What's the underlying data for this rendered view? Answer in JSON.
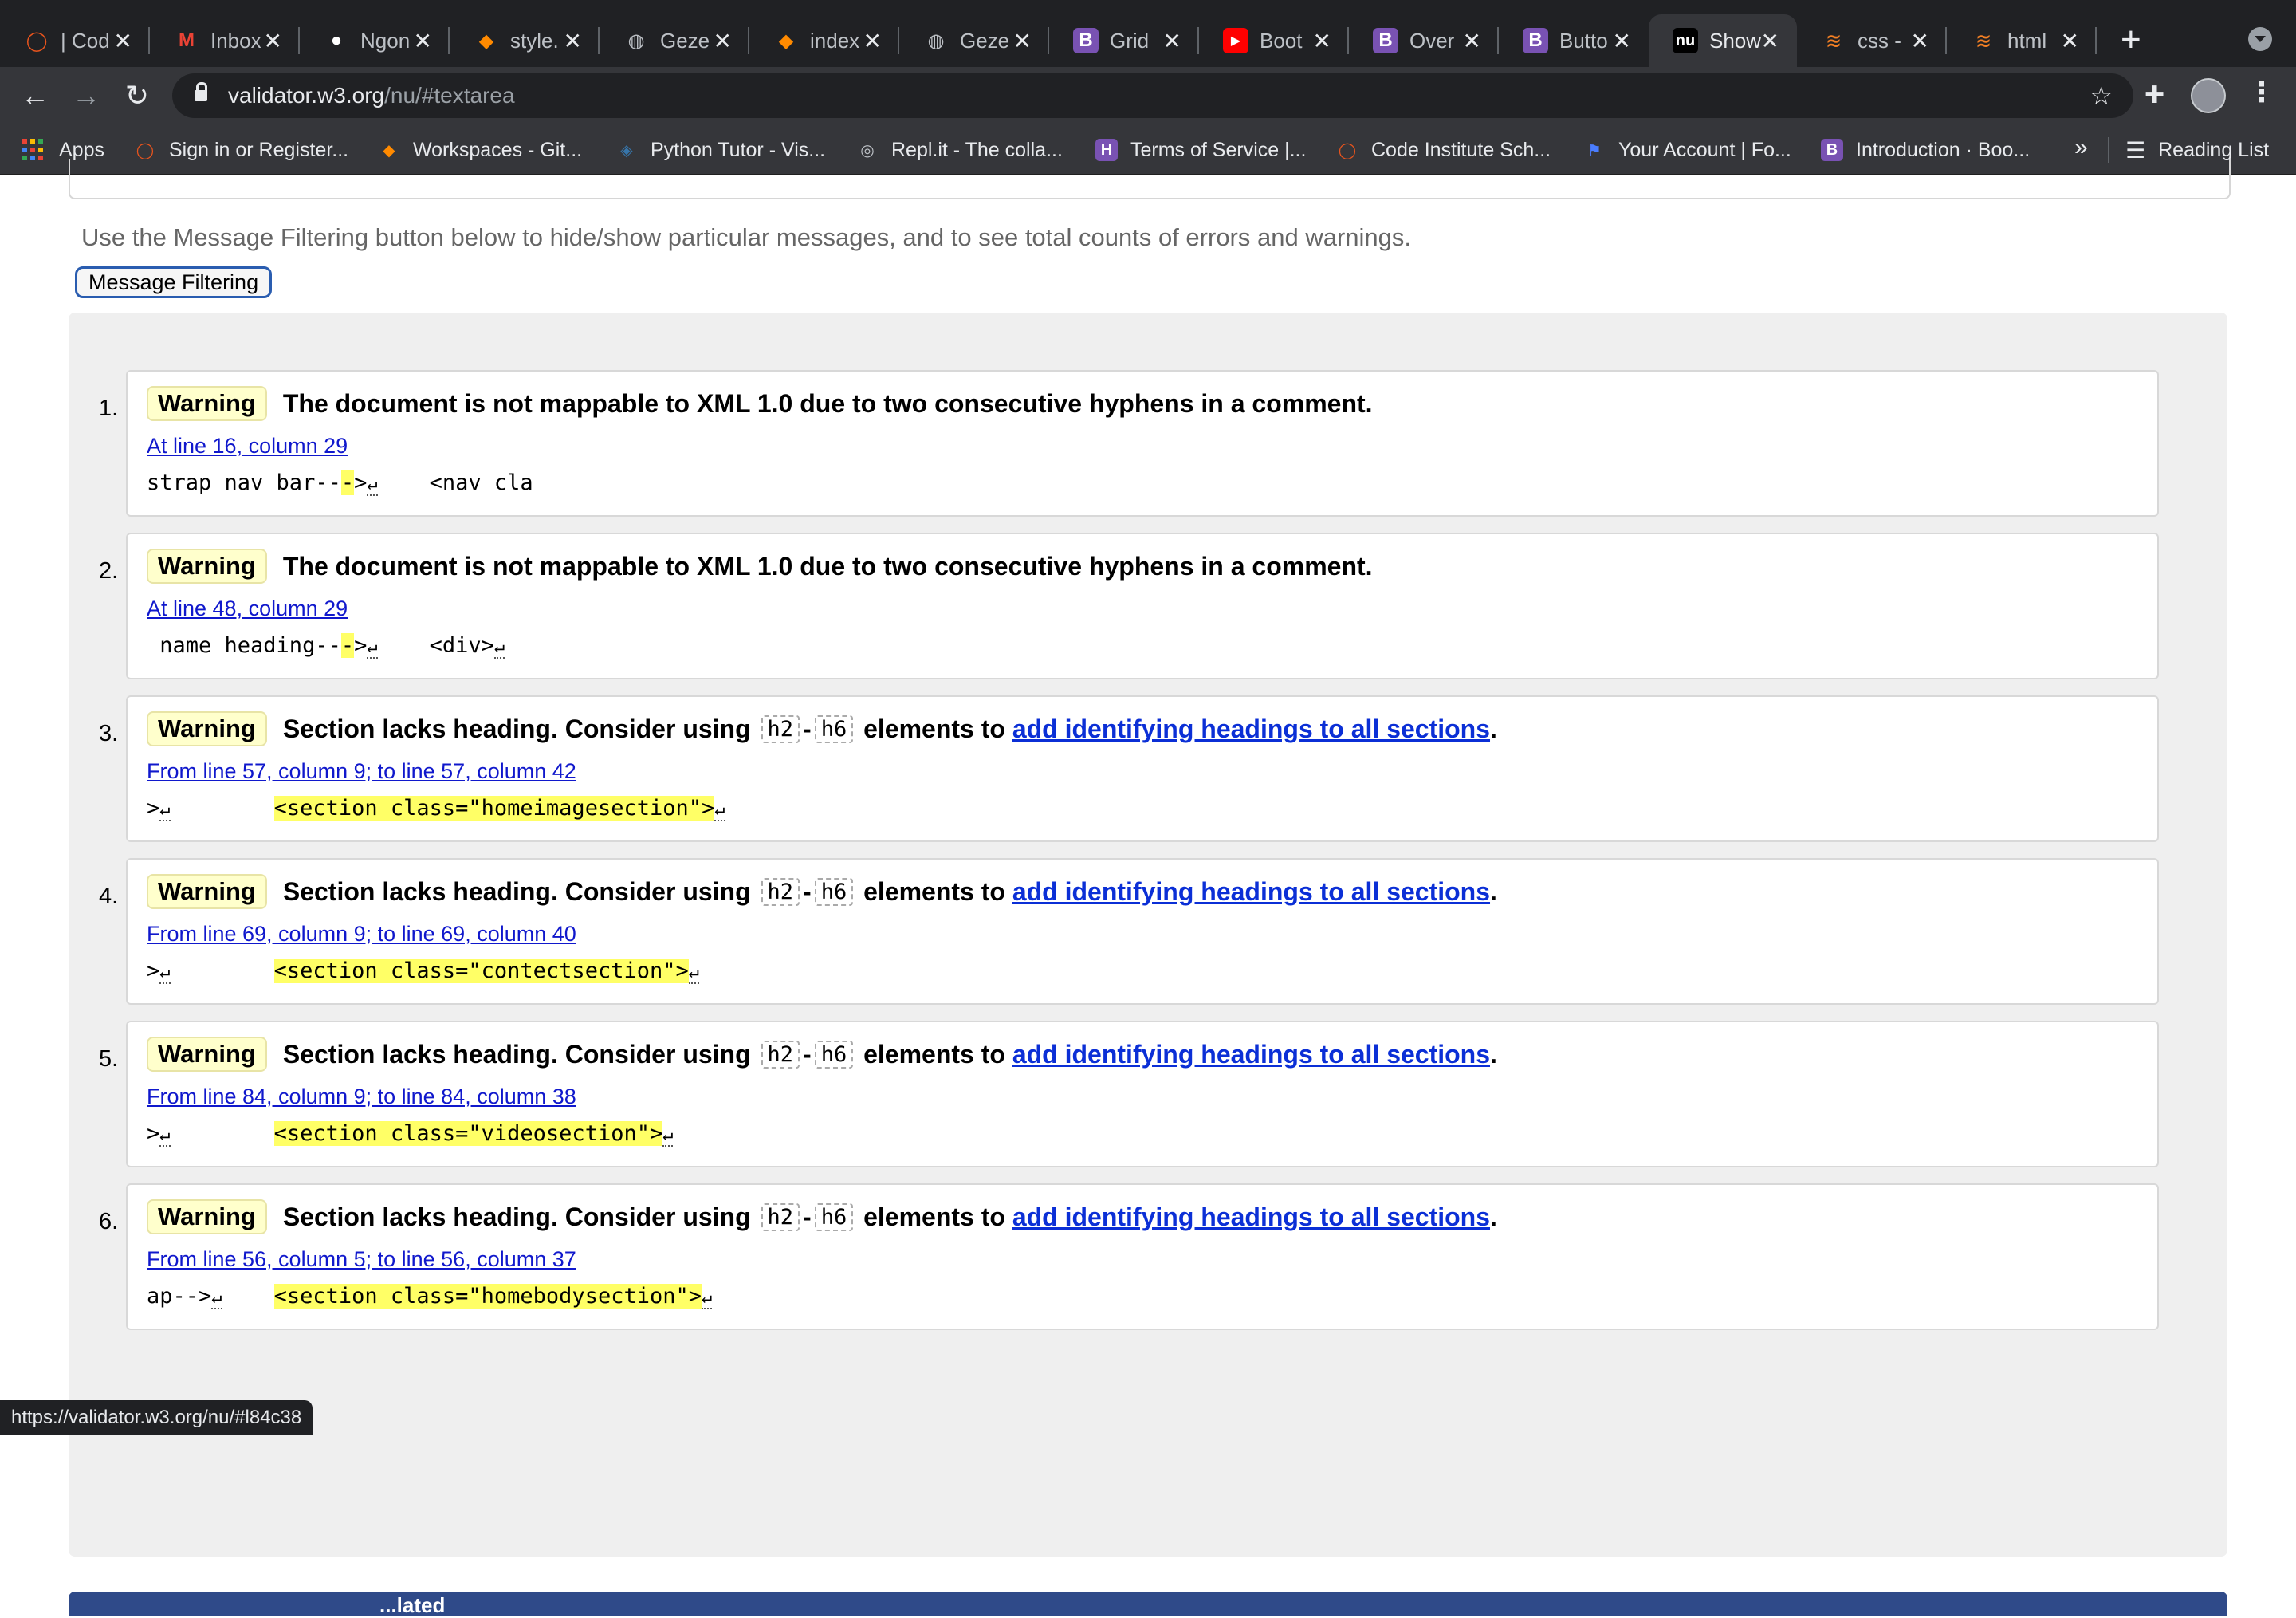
{
  "browser": {
    "tabs": [
      {
        "title": "| Cod",
        "icon": "code-institute-icon",
        "color": "#e8541d"
      },
      {
        "title": "Inbox",
        "icon": "gmail-icon",
        "color": "#ea4335"
      },
      {
        "title": "Ngon",
        "icon": "github-icon",
        "color": "#ffffff"
      },
      {
        "title": "style.",
        "icon": "gitpod-icon",
        "color": "#ff8a00"
      },
      {
        "title": "Geze",
        "icon": "globe-icon",
        "color": "#bdc1c6"
      },
      {
        "title": "index",
        "icon": "gitpod-icon",
        "color": "#ff8a00"
      },
      {
        "title": "Geze",
        "icon": "globe-icon",
        "color": "#bdc1c6"
      },
      {
        "title": "Grid",
        "icon": "bootstrap-icon",
        "color": "#7952b3"
      },
      {
        "title": "Boot",
        "icon": "youtube-icon",
        "color": "#ff0000"
      },
      {
        "title": "Over",
        "icon": "bootstrap-icon",
        "color": "#7952b3"
      },
      {
        "title": "Butto",
        "icon": "bootstrap-icon",
        "color": "#7952b3"
      },
      {
        "title": "Show",
        "icon": "nu-validator-icon",
        "color": "#ffffff",
        "active": true
      },
      {
        "title": "css -",
        "icon": "stackoverflow-icon",
        "color": "#f48024"
      },
      {
        "title": "html",
        "icon": "stackoverflow-icon",
        "color": "#f48024"
      }
    ],
    "url_host": "validator.w3.org",
    "url_path": "/nu/#textarea",
    "bookmarks": [
      {
        "label": "Apps",
        "icon": "apps-grid-icon"
      },
      {
        "label": "Sign in or Register...",
        "icon": "code-institute-icon",
        "color": "#e8541d"
      },
      {
        "label": "Workspaces - Git...",
        "icon": "gitpod-icon",
        "color": "#ff8a00"
      },
      {
        "label": "Python Tutor - Vis...",
        "icon": "python-icon",
        "color": "#3776ab"
      },
      {
        "label": "Repl.it - The colla...",
        "icon": "replit-icon",
        "color": "#bdc1c6"
      },
      {
        "label": "Terms of Service |...",
        "icon": "heroku-icon",
        "color": "#7952b3"
      },
      {
        "label": "Code Institute Sch...",
        "icon": "code-institute-icon",
        "color": "#e8541d"
      },
      {
        "label": "Your Account | Fo...",
        "icon": "flag-icon",
        "color": "#4a7dff"
      },
      {
        "label": "Introduction · Boo...",
        "icon": "bootstrap-icon",
        "color": "#7952b3"
      }
    ],
    "bookmarks_more": "»",
    "reading_list": "Reading List",
    "status_url": "https://validator.w3.org/nu/#l84c38"
  },
  "page": {
    "filter_note": "Use the Message Filtering button below to hide/show particular messages, and to see total counts of errors and warnings.",
    "filter_button": "Message Filtering",
    "bottom_section_partial": "...lated"
  },
  "messages": [
    {
      "num": "1.",
      "type": "Warning",
      "text": "The document is not mappable to XML 1.0 due to two consecutive hyphens in a comment.",
      "location": "At line 16, column 29",
      "extract_pre": "strap nav bar--",
      "extract_mark": "-",
      "extract_post": ">",
      "extract_tail": "    <nav cla",
      "extract_tail_ret": ""
    },
    {
      "num": "2.",
      "type": "Warning",
      "text": "The document is not mappable to XML 1.0 due to two consecutive hyphens in a comment.",
      "location": "At line 48, column 29",
      "extract_pre": " name heading--",
      "extract_mark": "-",
      "extract_post": ">",
      "extract_tail": "    <div>",
      "extract_tail_ret": "↵"
    },
    {
      "num": "3.",
      "type": "Warning",
      "text_a": "Section lacks heading. Consider using ",
      "chip1": "h2",
      "dash": "-",
      "chip2": "h6",
      "text_b": " elements to ",
      "link": "add identifying headings to all sections",
      "text_c": ".",
      "location": "From line 57, column 9; to line 57, column 42",
      "extract_pre": ">",
      "extract_gap": "        ",
      "extract_mark": "<section class=\"homeimagesection\">"
    },
    {
      "num": "4.",
      "type": "Warning",
      "text_a": "Section lacks heading. Consider using ",
      "chip1": "h2",
      "dash": "-",
      "chip2": "h6",
      "text_b": " elements to ",
      "link": "add identifying headings to all sections",
      "text_c": ".",
      "location": "From line 69, column 9; to line 69, column 40",
      "extract_pre": ">",
      "extract_gap": "        ",
      "extract_mark": "<section class=\"contectsection\">"
    },
    {
      "num": "5.",
      "type": "Warning",
      "text_a": "Section lacks heading. Consider using ",
      "chip1": "h2",
      "dash": "-",
      "chip2": "h6",
      "text_b": " elements to ",
      "link": "add identifying headings to all sections",
      "text_c": ".",
      "location": "From line 84, column 9; to line 84, column 38",
      "extract_pre": ">",
      "extract_gap": "        ",
      "extract_mark": "<section class=\"videosection\">"
    },
    {
      "num": "6.",
      "type": "Warning",
      "text_a": "Section lacks heading. Consider using ",
      "chip1": "h2",
      "dash": "-",
      "chip2": "h6",
      "text_b": " elements to ",
      "link": "add identifying headings to all sections",
      "text_c": ".",
      "location": "From line 56, column 5; to line 56, column 37",
      "extract_pre": "ap-->",
      "extract_gap": "    ",
      "extract_mark": "<section class=\"homebodysection\">"
    }
  ],
  "glyphs": {
    "close": "✕",
    "ret": "↵",
    "back": "←",
    "forward": "→",
    "reload": "↻",
    "star": "☆",
    "puzzle": "✚",
    "dots": "⋮",
    "plus": "+",
    "list": "☰"
  }
}
